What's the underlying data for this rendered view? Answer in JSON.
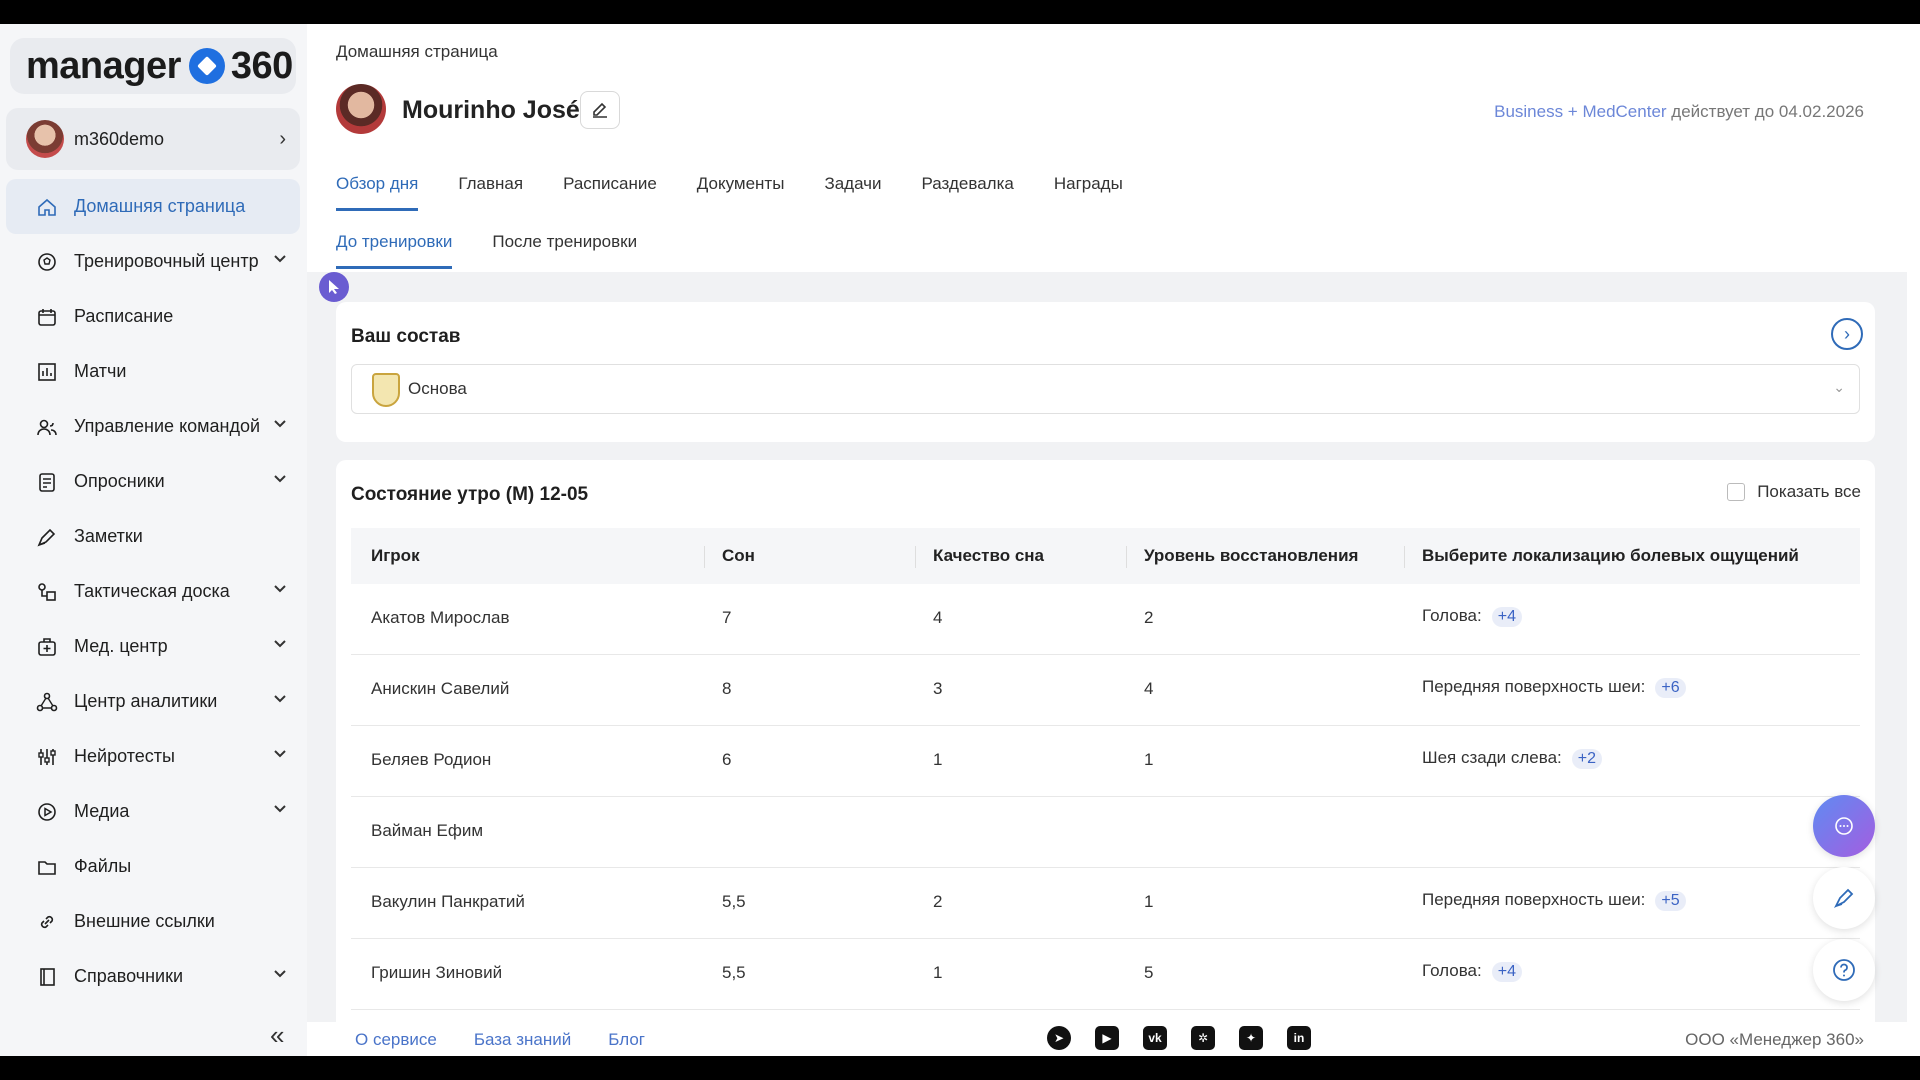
{
  "app": {
    "logo_text": "manager",
    "logo_number": "360"
  },
  "user": {
    "name": "m360demo"
  },
  "sidebar": {
    "items": [
      {
        "label": "Домашняя страница",
        "icon": "home-icon",
        "active": true
      },
      {
        "label": "Тренировочный центр",
        "icon": "soccer-ball-icon",
        "expandable": true
      },
      {
        "label": "Расписание",
        "icon": "calendar-icon"
      },
      {
        "label": "Матчи",
        "icon": "bar-chart-icon"
      },
      {
        "label": "Управление командой",
        "icon": "team-icon",
        "expandable": true
      },
      {
        "label": "Опросники",
        "icon": "questionnaire-icon",
        "expandable": true
      },
      {
        "label": "Заметки",
        "icon": "pen-icon"
      },
      {
        "label": "Тактическая доска",
        "icon": "tactics-icon",
        "expandable": true
      },
      {
        "label": "Мед. центр",
        "icon": "medkit-icon",
        "expandable": true
      },
      {
        "label": "Центр аналитики",
        "icon": "analytics-icon",
        "expandable": true
      },
      {
        "label": "Нейротесты",
        "icon": "sliders-icon",
        "expandable": true
      },
      {
        "label": "Медиа",
        "icon": "play-icon",
        "expandable": true
      },
      {
        "label": "Файлы",
        "icon": "folder-icon"
      },
      {
        "label": "Внешние ссылки",
        "icon": "link-icon"
      },
      {
        "label": "Справочники",
        "icon": "book-icon",
        "expandable": true
      }
    ],
    "collapse_glyph": "«"
  },
  "header": {
    "breadcrumb": "Домашняя страница",
    "coach_name": "Mourinho José",
    "license_accent": "Business + MedCenter",
    "license_rest": " действует до 04.02.2026"
  },
  "tabs": [
    {
      "label": "Обзор дня",
      "active": true
    },
    {
      "label": "Главная"
    },
    {
      "label": "Расписание"
    },
    {
      "label": "Документы"
    },
    {
      "label": "Задачи"
    },
    {
      "label": "Раздевалка"
    },
    {
      "label": "Награды"
    }
  ],
  "subtabs": [
    {
      "label": "До тренировки",
      "active": true
    },
    {
      "label": "После тренировки"
    }
  ],
  "squad_card": {
    "title": "Ваш состав",
    "selected": "Основа"
  },
  "state_card": {
    "title": "Состояние утро (М) 12-05",
    "show_all": "Показать все",
    "columns": [
      "Игрок",
      "Сон",
      "Качество сна",
      "Уровень восстановления",
      "Выберите локализацию болевых ощущений"
    ],
    "rows": [
      {
        "player": "Акатов Мирослав",
        "sleep": "7",
        "quality": "4",
        "recovery": "2",
        "pain": "Голова:",
        "more": "+4"
      },
      {
        "player": "Анискин Савелий",
        "sleep": "8",
        "quality": "3",
        "recovery": "4",
        "pain": "Передняя поверхность шеи:",
        "more": "+6"
      },
      {
        "player": "Беляев Родион",
        "sleep": "6",
        "quality": "1",
        "recovery": "1",
        "pain": "Шея сзади слева:",
        "more": "+2"
      },
      {
        "player": "Вайман Ефим",
        "sleep": "",
        "quality": "",
        "recovery": "",
        "pain": "",
        "more": ""
      },
      {
        "player": "Вакулин Панкратий",
        "sleep": "5,5",
        "quality": "2",
        "recovery": "1",
        "pain": "Передняя поверхность шеи:",
        "more": "+5"
      },
      {
        "player": "Гришин Зиновий",
        "sleep": "5,5",
        "quality": "1",
        "recovery": "5",
        "pain": "Голова:",
        "more": "+4"
      }
    ]
  },
  "footer": {
    "links": [
      "О сервисе",
      "База знаний",
      "Блог"
    ],
    "socials": [
      "telegram-icon",
      "youtube-icon",
      "vk-icon",
      "dzen-icon",
      "star-icon",
      "linkedin-icon"
    ],
    "company": "ООО «Менеджер 360»"
  },
  "colors": {
    "accent": "#2f6bb8",
    "license_accent": "#6c87d8",
    "tag_bg": "#e9edf8",
    "tag_text": "#3b63c4"
  }
}
